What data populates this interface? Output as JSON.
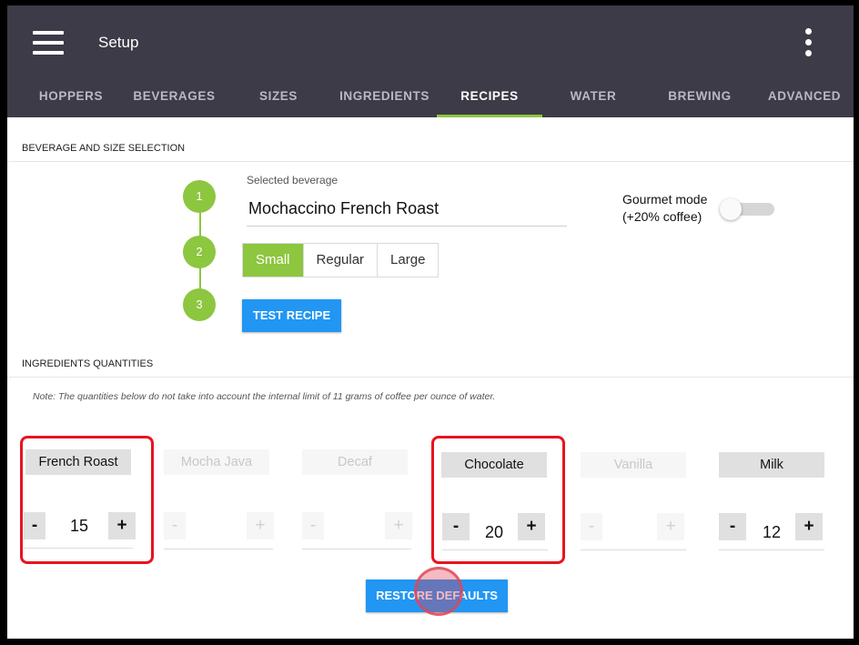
{
  "app": {
    "title": "Setup",
    "icons": {
      "menu": "hamburger-menu-icon",
      "more": "more-vertical-icon"
    }
  },
  "tabs": [
    {
      "label": "HOPPERS",
      "active": false
    },
    {
      "label": "BEVERAGES",
      "active": false
    },
    {
      "label": "SIZES",
      "active": false
    },
    {
      "label": "INGREDIENTS",
      "active": false
    },
    {
      "label": "RECIPES",
      "active": true
    },
    {
      "label": "WATER",
      "active": false
    },
    {
      "label": "BREWING",
      "active": false
    },
    {
      "label": "ADVANCED",
      "active": false
    }
  ],
  "beverage_section": {
    "header": "BEVERAGE AND SIZE SELECTION",
    "steps": [
      "1",
      "2",
      "3"
    ],
    "selected_label": "Selected beverage",
    "selected_value": "Mochaccino French Roast",
    "gourmet_line1": "Gourmet mode",
    "gourmet_line2": "(+20% coffee)",
    "gourmet_on": false,
    "sizes": [
      "Small",
      "Regular",
      "Large"
    ],
    "selected_size": "Small",
    "test_button": "TEST RECIPE"
  },
  "ingredients_section": {
    "header": "INGREDIENTS QUANTITIES",
    "note": "Note: The quantities below do not take into account the internal limit of 11 grams of coffee per ounce of water.",
    "minus": "-",
    "plus": "+",
    "items": [
      {
        "name": "French Roast",
        "value": "15",
        "enabled": true,
        "highlighted": true
      },
      {
        "name": "Mocha Java",
        "value": "",
        "enabled": false,
        "highlighted": false
      },
      {
        "name": "Decaf",
        "value": "",
        "enabled": false,
        "highlighted": false
      },
      {
        "name": "Chocolate",
        "value": "20",
        "enabled": true,
        "highlighted": true
      },
      {
        "name": "Vanilla",
        "value": "",
        "enabled": false,
        "highlighted": false
      },
      {
        "name": "Milk",
        "value": "12",
        "enabled": true,
        "highlighted": false
      }
    ],
    "restore_button": "RESTORE DEFAULTS"
  },
  "colors": {
    "appbar": "#3c3b47",
    "accent_green": "#8dc63f",
    "button_blue": "#2196f3",
    "highlight_red": "#e8131f"
  }
}
